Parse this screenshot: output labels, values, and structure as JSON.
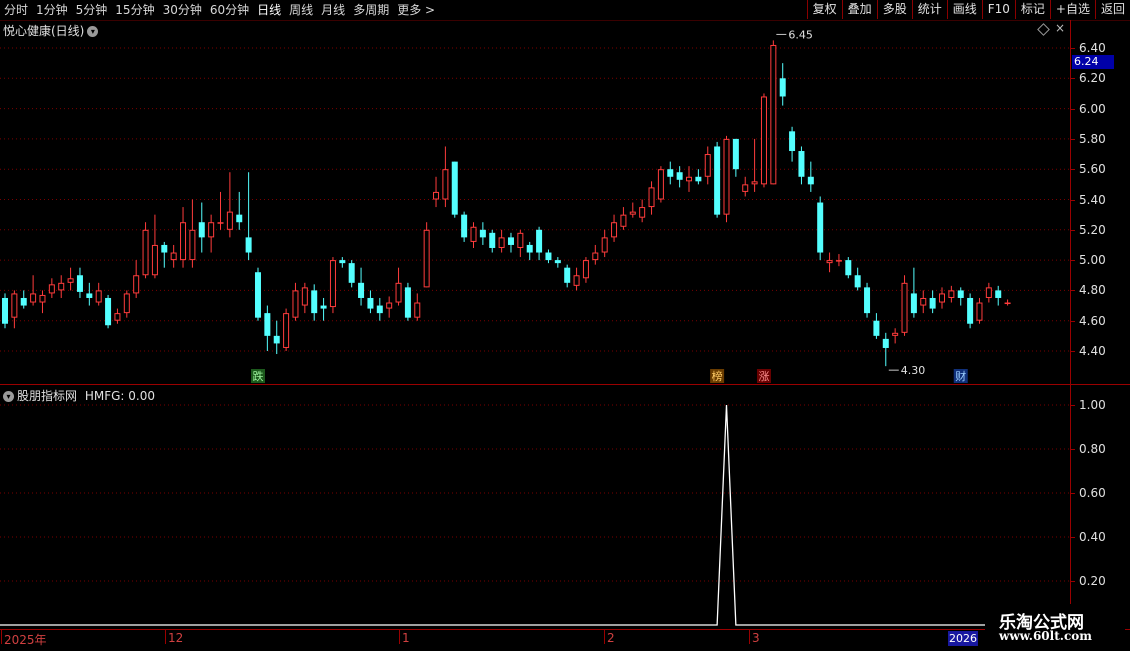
{
  "toolbar": {
    "periods": [
      "分时",
      "1分钟",
      "5分钟",
      "15分钟",
      "30分钟",
      "60分钟",
      "日线",
      "周线",
      "月线",
      "多周期",
      "更多 >"
    ],
    "active_period": "日线",
    "buttons": [
      "复权",
      "叠加",
      "多股",
      "统计",
      "画线",
      "F10",
      "标记",
      "+自选",
      "返回"
    ]
  },
  "main_panel": {
    "stock_title": "悦心健康(日线)",
    "current_price": "6.24",
    "high_annotation": "6.45",
    "low_annotation": "4.30",
    "event_markers": [
      "跌",
      "榜",
      "涨",
      "财"
    ]
  },
  "sub_panel": {
    "indicator_title": "股朋指标网",
    "indicator_value": "HMFG: 0.00"
  },
  "axis": {
    "price_ticks": [
      "6.40",
      "6.20",
      "6.00",
      "5.80",
      "5.60",
      "5.40",
      "5.20",
      "5.00",
      "4.80",
      "4.60",
      "4.40"
    ],
    "indicator_ticks": [
      "1.00",
      "0.80",
      "0.60",
      "0.40",
      "0.20"
    ]
  },
  "date_axis": {
    "labels": [
      "2025年",
      "12",
      "1",
      "2",
      "3"
    ],
    "right_label": "2026"
  },
  "watermark": {
    "brand": "乐淘公式网",
    "url": "www.60lt.com"
  },
  "colors": {
    "up": "#ff3c3c",
    "down": "#54ffff",
    "grid": "#7a0000",
    "indicator_line": "#ffffff"
  },
  "chart_data": {
    "type": "candlestick",
    "ylim": [
      4.3,
      6.5
    ],
    "candles": [
      [
        4.75,
        4.58,
        4.78,
        4.55
      ],
      [
        4.62,
        4.78,
        4.8,
        4.55
      ],
      [
        4.75,
        4.7,
        4.8,
        4.68
      ],
      [
        4.72,
        4.78,
        4.9,
        4.7
      ],
      [
        4.72,
        4.77,
        4.8,
        4.65
      ],
      [
        4.78,
        4.84,
        4.88,
        4.75
      ],
      [
        4.8,
        4.85,
        4.9,
        4.75
      ],
      [
        4.85,
        4.88,
        4.95,
        4.8
      ],
      [
        4.9,
        4.79,
        4.95,
        4.75
      ],
      [
        4.78,
        4.75,
        4.85,
        4.7
      ],
      [
        4.72,
        4.8,
        4.85,
        4.7
      ],
      [
        4.75,
        4.57,
        4.77,
        4.55
      ],
      [
        4.6,
        4.65,
        4.68,
        4.58
      ],
      [
        4.65,
        4.78,
        4.8,
        4.62
      ],
      [
        4.78,
        4.9,
        5.0,
        4.75
      ],
      [
        4.9,
        5.2,
        5.25,
        4.88
      ],
      [
        4.9,
        5.1,
        5.3,
        4.88
      ],
      [
        5.1,
        5.05,
        5.12,
        4.95
      ],
      [
        5.0,
        5.05,
        5.1,
        4.95
      ],
      [
        5.0,
        5.25,
        5.35,
        4.95
      ],
      [
        5.0,
        5.2,
        5.4,
        4.95
      ],
      [
        5.25,
        5.15,
        5.38,
        5.05
      ],
      [
        5.15,
        5.25,
        5.3,
        5.05
      ],
      [
        5.25,
        5.25,
        5.45,
        5.2
      ],
      [
        5.2,
        5.32,
        5.58,
        5.15
      ],
      [
        5.3,
        5.25,
        5.45,
        5.2
      ],
      [
        5.15,
        5.05,
        5.58,
        5.0
      ],
      [
        4.92,
        4.62,
        4.95,
        4.6
      ],
      [
        4.65,
        4.5,
        4.7,
        4.4
      ],
      [
        4.5,
        4.45,
        4.6,
        4.38
      ],
      [
        4.42,
        4.65,
        4.68,
        4.4
      ],
      [
        4.62,
        4.8,
        4.85,
        4.6
      ],
      [
        4.7,
        4.82,
        4.85,
        4.65
      ],
      [
        4.8,
        4.65,
        4.84,
        4.6
      ],
      [
        4.7,
        4.68,
        4.75,
        4.6
      ],
      [
        4.69,
        5.0,
        5.02,
        4.65
      ],
      [
        5.0,
        4.98,
        5.02,
        4.95
      ],
      [
        4.98,
        4.85,
        5.0,
        4.82
      ],
      [
        4.85,
        4.75,
        4.95,
        4.7
      ],
      [
        4.75,
        4.68,
        4.8,
        4.65
      ],
      [
        4.7,
        4.65,
        4.75,
        4.6
      ],
      [
        4.68,
        4.72,
        4.76,
        4.62
      ],
      [
        4.72,
        4.85,
        4.95,
        4.7
      ],
      [
        4.82,
        4.62,
        4.85,
        4.6
      ],
      [
        4.62,
        4.72,
        4.78,
        4.6
      ],
      [
        4.82,
        5.2,
        5.25,
        4.82
      ],
      [
        5.4,
        5.45,
        5.55,
        5.35
      ],
      [
        5.4,
        5.6,
        5.75,
        5.35
      ],
      [
        5.65,
        5.3,
        5.65,
        5.28
      ],
      [
        5.3,
        5.15,
        5.32,
        5.12
      ],
      [
        5.12,
        5.22,
        5.25,
        5.08
      ],
      [
        5.2,
        5.15,
        5.25,
        5.1
      ],
      [
        5.18,
        5.08,
        5.2,
        5.05
      ],
      [
        5.08,
        5.15,
        5.2,
        5.05
      ],
      [
        5.15,
        5.1,
        5.18,
        5.05
      ],
      [
        5.08,
        5.18,
        5.2,
        5.02
      ],
      [
        5.1,
        5.05,
        5.12,
        5.0
      ],
      [
        5.2,
        5.05,
        5.22,
        5.0
      ],
      [
        5.05,
        5.0,
        5.07,
        4.98
      ],
      [
        5.0,
        4.98,
        5.02,
        4.95
      ],
      [
        4.95,
        4.85,
        4.97,
        4.82
      ],
      [
        4.83,
        4.9,
        4.95,
        4.8
      ],
      [
        4.88,
        5.0,
        5.02,
        4.85
      ],
      [
        5.0,
        5.05,
        5.1,
        4.97
      ],
      [
        5.05,
        5.15,
        5.2,
        5.02
      ],
      [
        5.15,
        5.25,
        5.3,
        5.12
      ],
      [
        5.22,
        5.3,
        5.35,
        5.2
      ],
      [
        5.3,
        5.32,
        5.38,
        5.28
      ],
      [
        5.28,
        5.35,
        5.4,
        5.25
      ],
      [
        5.35,
        5.48,
        5.52,
        5.3
      ],
      [
        5.4,
        5.6,
        5.62,
        5.38
      ],
      [
        5.6,
        5.55,
        5.65,
        5.5
      ],
      [
        5.58,
        5.53,
        5.62,
        5.48
      ],
      [
        5.52,
        5.55,
        5.62,
        5.45
      ],
      [
        5.55,
        5.52,
        5.6,
        5.5
      ],
      [
        5.55,
        5.7,
        5.75,
        5.5
      ],
      [
        5.75,
        5.3,
        5.78,
        5.28
      ],
      [
        5.3,
        5.8,
        5.82,
        5.25
      ],
      [
        5.8,
        5.6,
        5.8,
        5.55
      ],
      [
        5.45,
        5.5,
        5.55,
        5.42
      ],
      [
        5.5,
        5.52,
        5.8,
        5.45
      ],
      [
        5.5,
        6.08,
        6.1,
        5.48
      ],
      [
        5.5,
        6.42,
        6.45,
        5.5
      ],
      [
        6.2,
        6.08,
        6.3,
        6.02
      ],
      [
        5.85,
        5.72,
        5.88,
        5.65
      ],
      [
        5.72,
        5.55,
        5.75,
        5.5
      ],
      [
        5.55,
        5.5,
        5.65,
        5.45
      ],
      [
        5.38,
        5.05,
        5.42,
        5.0
      ],
      [
        4.98,
        5.0,
        5.05,
        4.92
      ],
      [
        5.0,
        5.0,
        5.04,
        4.96
      ],
      [
        5.0,
        4.9,
        5.02,
        4.88
      ],
      [
        4.9,
        4.82,
        4.95,
        4.8
      ],
      [
        4.82,
        4.65,
        4.85,
        4.62
      ],
      [
        4.6,
        4.5,
        4.65,
        4.48
      ],
      [
        4.48,
        4.42,
        4.52,
        4.3
      ],
      [
        4.5,
        4.52,
        4.55,
        4.45
      ],
      [
        4.52,
        4.85,
        4.9,
        4.5
      ],
      [
        4.78,
        4.65,
        4.95,
        4.62
      ],
      [
        4.7,
        4.75,
        4.8,
        4.65
      ],
      [
        4.75,
        4.68,
        4.8,
        4.65
      ],
      [
        4.72,
        4.78,
        4.82,
        4.68
      ],
      [
        4.75,
        4.8,
        4.83,
        4.72
      ],
      [
        4.8,
        4.75,
        4.82,
        4.7
      ],
      [
        4.75,
        4.58,
        4.78,
        4.55
      ],
      [
        4.6,
        4.72,
        4.75,
        4.58
      ],
      [
        4.75,
        4.82,
        4.85,
        4.72
      ],
      [
        4.8,
        4.75,
        4.83,
        4.7
      ],
      [
        4.72,
        4.72,
        4.74,
        4.7
      ]
    ],
    "indicator": {
      "name": "HMFG",
      "ylim": [
        0,
        1.05
      ],
      "spike_index": 77,
      "spike_value": 1.0
    }
  }
}
